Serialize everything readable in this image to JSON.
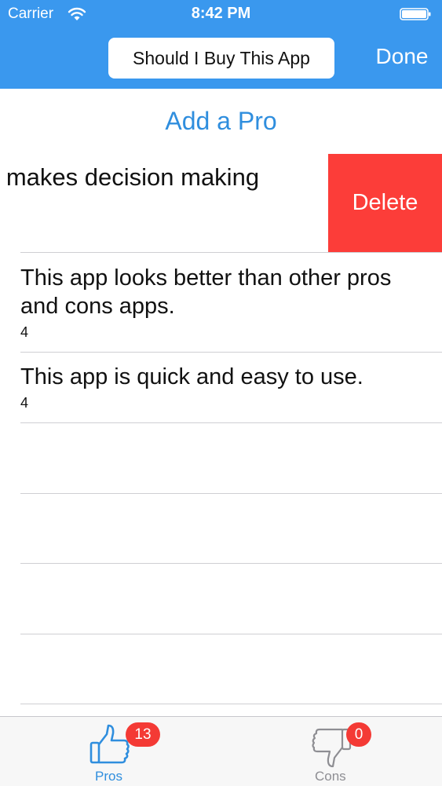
{
  "status_bar": {
    "carrier": "Carrier",
    "time": "8:42 PM"
  },
  "nav": {
    "title": "Should I Buy This App",
    "done_label": "Done"
  },
  "add_button_label": "Add a Pro",
  "swiped_row": {
    "text": "o makes decision making",
    "delete_label": "Delete"
  },
  "pros": [
    {
      "title": "This app looks better than other pros and cons apps.",
      "count": "4"
    },
    {
      "title": "This app is quick and easy to use.",
      "count": "4"
    }
  ],
  "tabbar": {
    "pros": {
      "label": "Pros",
      "badge": "13",
      "icon": "thumbs-up-icon"
    },
    "cons": {
      "label": "Cons",
      "badge": "0",
      "icon": "thumbs-down-icon"
    }
  },
  "colors": {
    "nav_background": "#3a98ee",
    "accent": "#2f8ede",
    "delete": "#fc3d39",
    "badge": "#f43a35",
    "inactive": "#8e8e93"
  }
}
